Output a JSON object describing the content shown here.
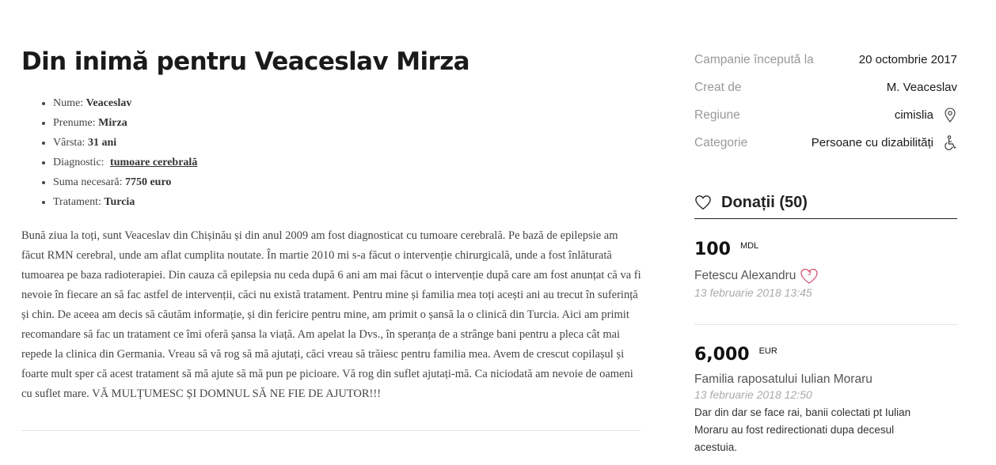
{
  "campaign": {
    "title": "Din inimă pentru Veaceslav Mirza",
    "facts": [
      {
        "label": "Nume:",
        "value": "Veaceslav"
      },
      {
        "label": "Prenume:",
        "value": "Mirza"
      },
      {
        "label": "Vârsta:",
        "value": "31 ani"
      },
      {
        "label": "Diagnostic:",
        "value": "tumoare cerebrală"
      },
      {
        "label": "Suma necesară:",
        "value": "7750 euro"
      },
      {
        "label": "Tratament:",
        "value": "Turcia"
      }
    ],
    "story": "Bună ziua la toți, sunt Veaceslav din Chișinău și din anul 2009 am fost diagnosticat cu tumoare cerebrală. Pe bază de epilepsie am făcut RMN cerebral, unde am aflat cumplita noutate. În martie 2010 mi s-a făcut o intervenție chirurgicală, unde a fost înlăturată tumoarea pe baza radioterapiei. Din cauza că epilepsia nu ceda după 6 ani am mai făcut o intervenție după care am fost anunțat că va fi nevoie în fiecare an să fac astfel de intervenții, căci nu există tratament. Pentru mine și familia mea toți acești ani au trecut în suferință și chin. De aceea am decis să căutăm informație, și din fericire pentru mine, am primit o șansă la o clinică din Turcia. Aici am primit recomandare să fac un tratament ce îmi oferă șansa la viață. Am apelat la Dvs., în speranța de a strânge bani pentru a pleca cât mai repede la clinica din Germania. Vreau să vă rog să mă ajutați, căci vreau să trăiesc pentru familia mea. Avem de crescut copilașul și foarte mult sper că acest tratament să mă ajute să mă pun pe picioare. Vă rog din suflet ajutați-mă. Ca niciodată am nevoie de oameni cu suflet mare. VĂ MULȚUMESC ȘI DOMNUL SĂ NE FIE DE AJUTOR!!!"
  },
  "info": {
    "started_label": "Campanie începută la",
    "started_value": "20 octombrie 2017",
    "creator_label": "Creat de",
    "creator_value": "M. Veaceslav",
    "region_label": "Regiune",
    "region_value": "cimislia",
    "region_icon": "location-pin-icon",
    "category_label": "Categorie",
    "category_value": "Persoane cu dizabilități",
    "category_icon": "wheelchair-icon"
  },
  "donations": {
    "heading": "Donații (50)",
    "items": [
      {
        "amount": "100",
        "currency": "MDL",
        "donor": "Fetescu Alexandru",
        "badge": "3",
        "date": "13 februarie 2018 13:45",
        "message": ""
      },
      {
        "amount": "6,000",
        "currency": "EUR",
        "donor": "Familia raposatului Iulian Moraru",
        "badge": "",
        "date": "13 februarie 2018 12:50",
        "message": "Dar din dar se face rai, banii colectati pt Iulian Moraru au fost redirectionati dupa decesul acestuia."
      }
    ]
  },
  "colors": {
    "accent_heart": "#d24a6a",
    "muted": "#999999"
  }
}
